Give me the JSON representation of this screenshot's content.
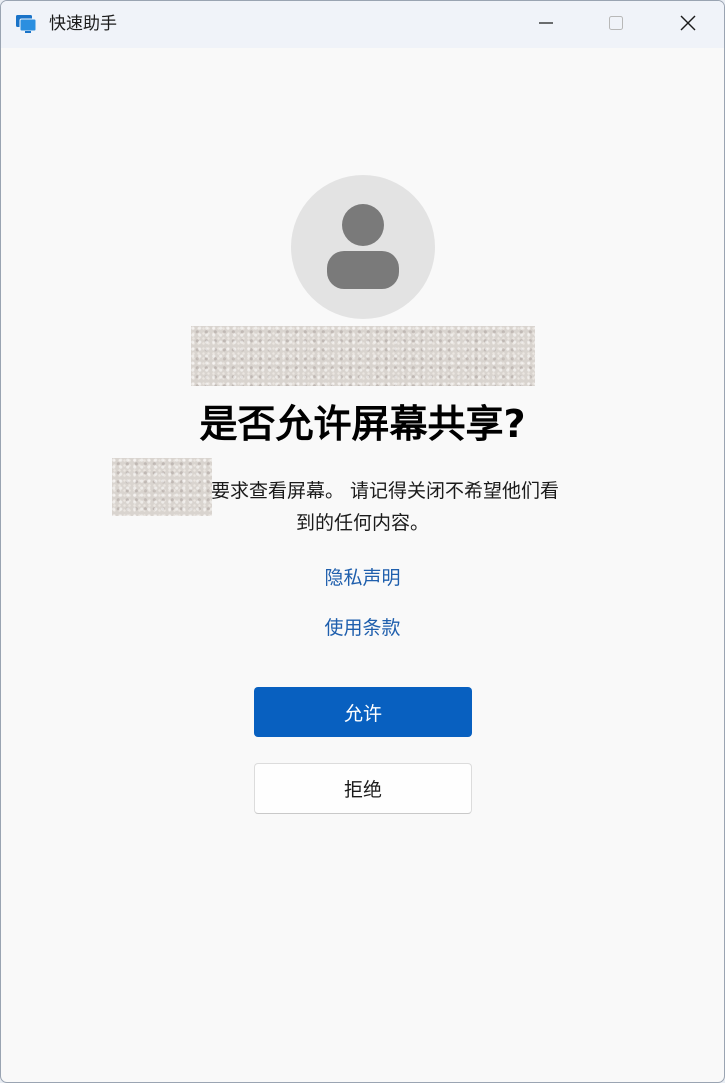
{
  "window": {
    "title": "快速助手",
    "icon": "monitor-icon",
    "controls": [
      "minimize-icon",
      "maximize-icon",
      "close-icon"
    ]
  },
  "dialog": {
    "avatar_icon": "person-icon",
    "heading": "是否允许屏幕共享?",
    "description_line1": "要求查看屏幕。 请记得关闭不希望他们看",
    "description_line2": "到的任何内容。",
    "privacy_link": "隐私声明",
    "terms_link": "使用条款",
    "allow_button": "允许",
    "deny_button": "拒绝"
  },
  "colors": {
    "accent": "#0860c0",
    "link": "#1f5fad",
    "background": "#f9f9f9",
    "titlebar": "#f0f3f9"
  }
}
